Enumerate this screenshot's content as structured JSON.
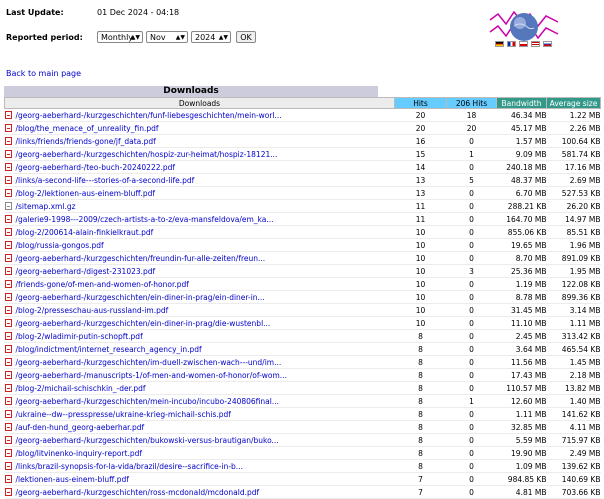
{
  "header": {
    "last_update_label": "Last Update:",
    "last_update_value": "01 Dec 2024 - 04:18",
    "reported_period_label": "Reported period:",
    "period_type": "Monthly",
    "month": "Nov",
    "year": "2024",
    "ok_label": "OK",
    "flags": [
      "de-flag",
      "fr-flag",
      "cz-flag",
      "us-flag",
      "ru-flag"
    ]
  },
  "back_link": "Back to main page",
  "section_title": "Downloads",
  "table": {
    "columns": [
      "Downloads",
      "Hits",
      "206 Hits",
      "Bandwidth",
      "Average size"
    ],
    "rows": [
      {
        "file": "/georg-aeberhard-/kurzgeschichten/funf-liebesgeschichten/mein-worl...",
        "hits": "20",
        "h206": "18",
        "bw": "46.34 MB",
        "avg": "1.22 MB",
        "icon": "pdf"
      },
      {
        "file": "/blog/the_menace_of_unreality_fin.pdf",
        "hits": "20",
        "h206": "20",
        "bw": "45.17 MB",
        "avg": "2.26 MB",
        "icon": "pdf"
      },
      {
        "file": "/links/friends/friends-gone/jf_data.pdf",
        "hits": "16",
        "h206": "0",
        "bw": "1.57 MB",
        "avg": "100.64 KB",
        "icon": "pdf"
      },
      {
        "file": "/georg-aeberhard-/kurzgeschichten/hospiz-zur-heimat/hospiz-18121...",
        "hits": "15",
        "h206": "1",
        "bw": "9.09 MB",
        "avg": "581.74 KB",
        "icon": "pdf"
      },
      {
        "file": "/georg-aeberhard-/teo-buch-20240222.pdf",
        "hits": "14",
        "h206": "0",
        "bw": "240.18 MB",
        "avg": "17.16 MB",
        "icon": "pdf"
      },
      {
        "file": "/links/a-second-life---stories-of-a-second-life.pdf",
        "hits": "13",
        "h206": "5",
        "bw": "48.37 MB",
        "avg": "2.69 MB",
        "icon": "pdf"
      },
      {
        "file": "/blog-2/lektionen-aus-einem-bluff.pdf",
        "hits": "13",
        "h206": "0",
        "bw": "6.70 MB",
        "avg": "527.53 KB",
        "icon": "pdf"
      },
      {
        "file": "/sitemap.xml.gz",
        "hits": "11",
        "h206": "0",
        "bw": "288.21 KB",
        "avg": "26.20 KB",
        "icon": "gz"
      },
      {
        "file": "/galerie9-1998---2009/czech-artists-a-to-z/eva-mansfeldova/em_ka...",
        "hits": "11",
        "h206": "0",
        "bw": "164.70 MB",
        "avg": "14.97 MB",
        "icon": "pdf"
      },
      {
        "file": "/blog-2/200614-alain-finkielkraut.pdf",
        "hits": "10",
        "h206": "0",
        "bw": "855.06 KB",
        "avg": "85.51 KB",
        "icon": "pdf"
      },
      {
        "file": "/blog/russia-gongos.pdf",
        "hits": "10",
        "h206": "0",
        "bw": "19.65 MB",
        "avg": "1.96 MB",
        "icon": "pdf"
      },
      {
        "file": "/georg-aeberhard-/kurzgeschichten/freundin-fur-alle-zeiten/freun...",
        "hits": "10",
        "h206": "0",
        "bw": "8.70 MB",
        "avg": "891.09 KB",
        "icon": "pdf"
      },
      {
        "file": "/georg-aeberhard-/digest-231023.pdf",
        "hits": "10",
        "h206": "3",
        "bw": "25.36 MB",
        "avg": "1.95 MB",
        "icon": "pdf"
      },
      {
        "file": "/friends-gone/of-men-and-women-of-honor.pdf",
        "hits": "10",
        "h206": "0",
        "bw": "1.19 MB",
        "avg": "122.08 KB",
        "icon": "pdf"
      },
      {
        "file": "/georg-aeberhard-/kurzgeschichten/ein-diner-in-prag/ein-diner-in...",
        "hits": "10",
        "h206": "0",
        "bw": "8.78 MB",
        "avg": "899.36 KB",
        "icon": "pdf"
      },
      {
        "file": "/blog-2/presseschau-aus-russland-im.pdf",
        "hits": "10",
        "h206": "0",
        "bw": "31.45 MB",
        "avg": "3.14 MB",
        "icon": "pdf"
      },
      {
        "file": "/georg-aeberhard-/kurzgeschichten/ein-diner-in-prag/die-wustenbl...",
        "hits": "10",
        "h206": "0",
        "bw": "11.10 MB",
        "avg": "1.11 MB",
        "icon": "pdf"
      },
      {
        "file": "/blog-2/wladimir-putin-schopft.pdf",
        "hits": "8",
        "h206": "0",
        "bw": "2.45 MB",
        "avg": "313.42 KB",
        "icon": "pdf"
      },
      {
        "file": "/blog/indictment/internet_research_agency_in.pdf",
        "hits": "8",
        "h206": "0",
        "bw": "3.64 MB",
        "avg": "465.54 KB",
        "icon": "pdf"
      },
      {
        "file": "/georg-aeberhard-/kurzgeschichten/im-duell-zwischen-wach---und/im...",
        "hits": "8",
        "h206": "0",
        "bw": "11.56 MB",
        "avg": "1.45 MB",
        "icon": "pdf"
      },
      {
        "file": "/georg-aeberhard-/manuscripts-1/of-men-and-women-of-honor/of-wom...",
        "hits": "8",
        "h206": "0",
        "bw": "17.43 MB",
        "avg": "2.18 MB",
        "icon": "pdf"
      },
      {
        "file": "/blog-2/michail-schischkin_-der.pdf",
        "hits": "8",
        "h206": "0",
        "bw": "110.57 MB",
        "avg": "13.82 MB",
        "icon": "pdf"
      },
      {
        "file": "/georg-aeberhard-/kurzgeschichten/mein-incubo/incubo-240806final...",
        "hits": "8",
        "h206": "1",
        "bw": "12.60 MB",
        "avg": "1.40 MB",
        "icon": "pdf"
      },
      {
        "file": "/ukraine--dw--presspresse/ukraine-krieg-michail-schis.pdf",
        "hits": "8",
        "h206": "0",
        "bw": "1.11 MB",
        "avg": "141.62 KB",
        "icon": "pdf"
      },
      {
        "file": "/auf-den-hund_georg-aeberhar.pdf",
        "hits": "8",
        "h206": "0",
        "bw": "32.85 MB",
        "avg": "4.11 MB",
        "icon": "pdf"
      },
      {
        "file": "/georg-aeberhard-/kurzgeschichten/bukowski-versus-brautigan/buko...",
        "hits": "8",
        "h206": "0",
        "bw": "5.59 MB",
        "avg": "715.97 KB",
        "icon": "pdf"
      },
      {
        "file": "/blog/litvinenko-inquiry-report.pdf",
        "hits": "8",
        "h206": "0",
        "bw": "19.90 MB",
        "avg": "2.49 MB",
        "icon": "pdf"
      },
      {
        "file": "/links/brazil-synopsis-for-la-vida/brazil/desire--sacrifice-in-b...",
        "hits": "8",
        "h206": "0",
        "bw": "1.09 MB",
        "avg": "139.62 KB",
        "icon": "pdf"
      },
      {
        "file": "/lektionen-aus-einem-bluff.pdf",
        "hits": "7",
        "h206": "0",
        "bw": "984.85 KB",
        "avg": "140.69 KB",
        "icon": "pdf"
      },
      {
        "file": "/georg-aeberhard-/kurzgeschichten/ross-mcdonald/mcdonald.pdf",
        "hits": "7",
        "h206": "0",
        "bw": "4.81 MB",
        "avg": "703.66 KB",
        "icon": "pdf"
      }
    ]
  },
  "colors": {
    "hits_header": "#66ccff",
    "bandwidth_header": "#339988",
    "link": "#0000cc",
    "title_bar": "#ccccdd"
  }
}
